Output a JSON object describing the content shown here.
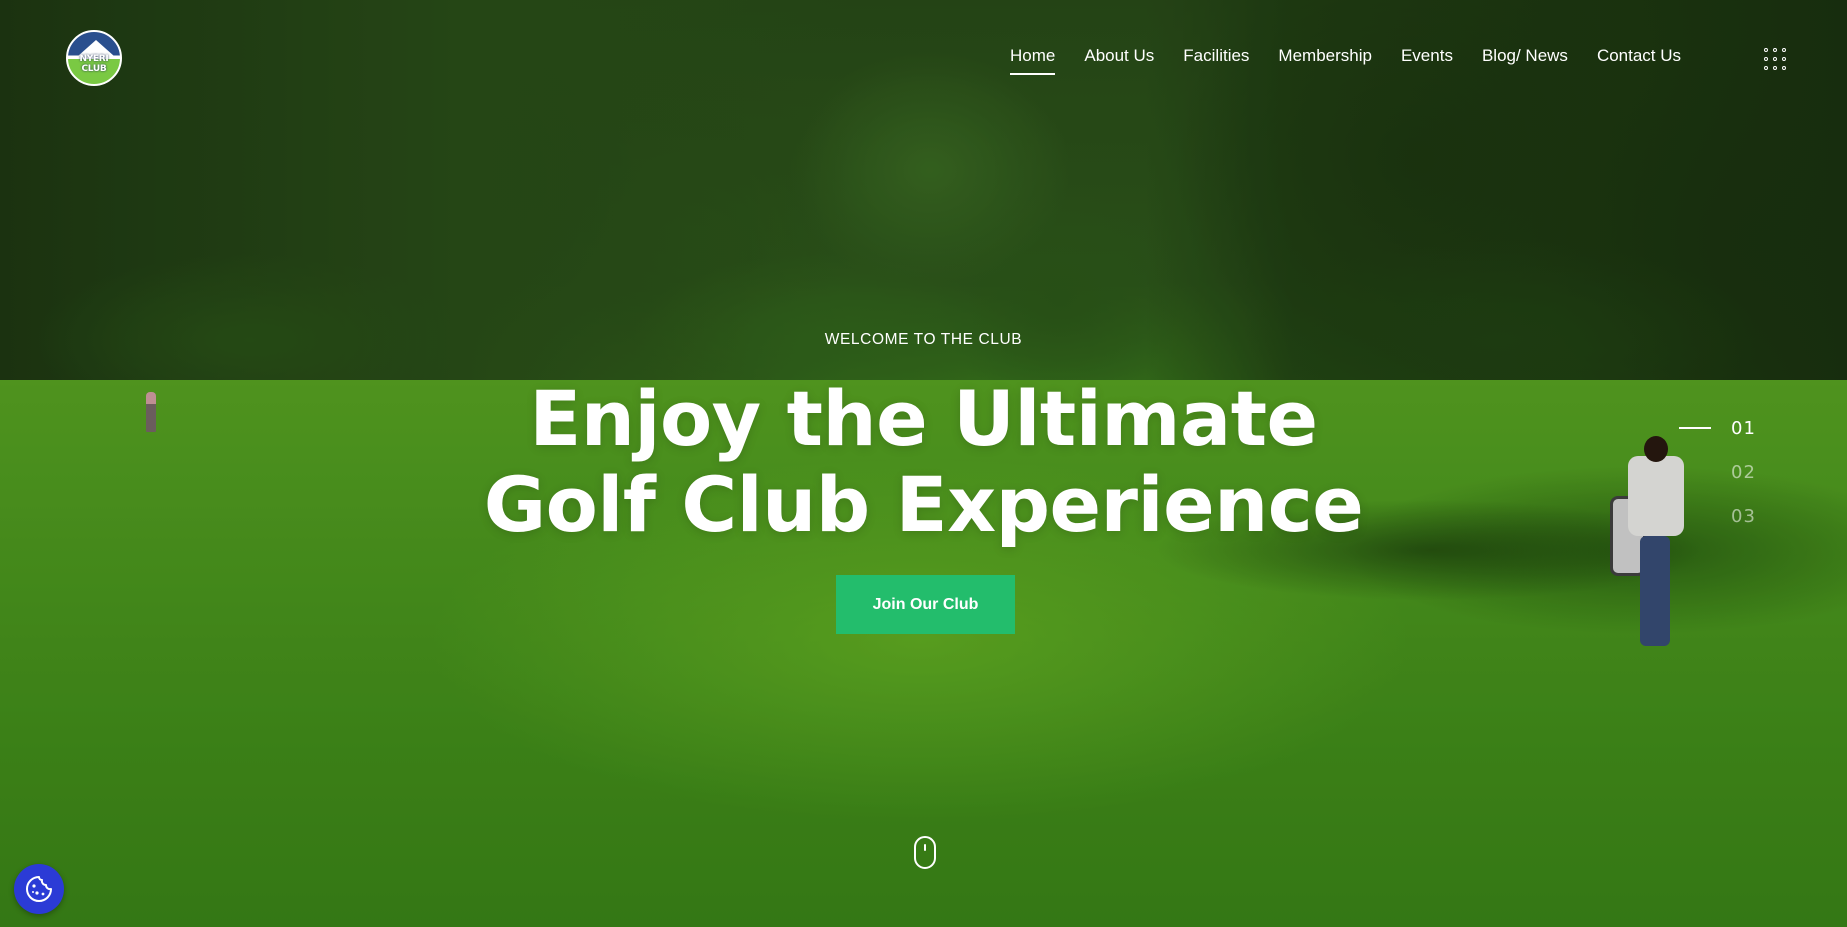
{
  "brand": {
    "logo_text": "NYERI CLUB"
  },
  "nav": {
    "items": [
      {
        "label": "Home",
        "active": true
      },
      {
        "label": "About Us",
        "active": false
      },
      {
        "label": "Facilities",
        "active": false
      },
      {
        "label": "Membership",
        "active": false
      },
      {
        "label": "Events",
        "active": false
      },
      {
        "label": "Blog/ News",
        "active": false
      },
      {
        "label": "Contact Us",
        "active": false
      }
    ],
    "menu_icon": "grid-dots-icon"
  },
  "hero": {
    "eyebrow": "WELCOME TO THE CLUB",
    "headline_line1": "Enjoy the Ultimate",
    "headline_line2": "Golf Club Experience",
    "cta_label": "Join Our Club",
    "cta_color": "#23bd6c"
  },
  "slider": {
    "slides": [
      "01",
      "02",
      "03"
    ],
    "active_index": 0
  },
  "scroll_hint_icon": "mouse-scroll-icon",
  "cookie_button": {
    "icon": "cookie-icon",
    "color": "#2b3bd6"
  }
}
